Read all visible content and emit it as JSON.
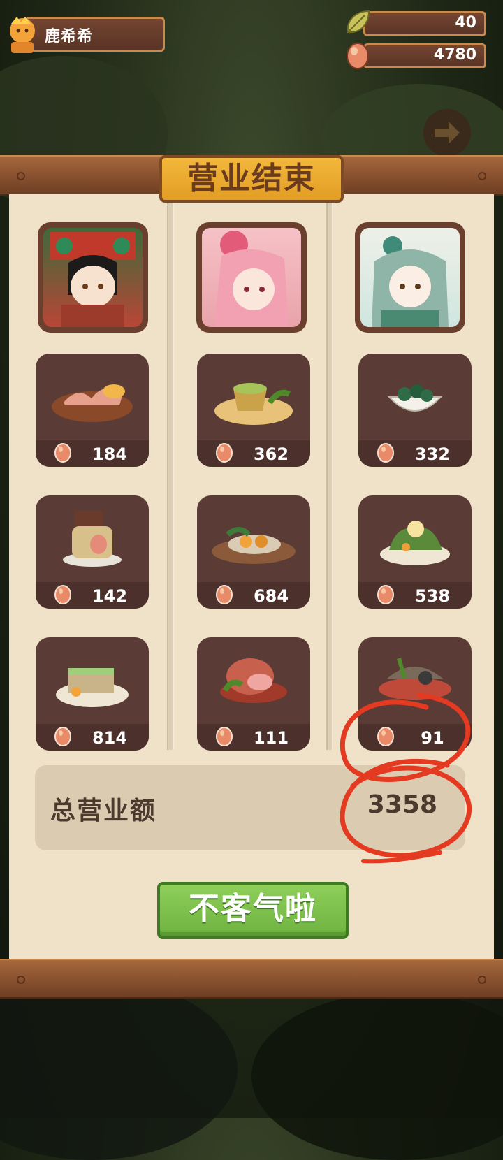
{
  "player": {
    "name": "鹿希希"
  },
  "resources": {
    "leaves": "40",
    "coins": "4780"
  },
  "dialog": {
    "title": "营业结束",
    "button_label": "不客气啦"
  },
  "total": {
    "label": "总营业额",
    "amount": "3358"
  },
  "dishes": [
    {
      "price": "184"
    },
    {
      "price": "362"
    },
    {
      "price": "332"
    },
    {
      "price": "142"
    },
    {
      "price": "684"
    },
    {
      "price": "538"
    },
    {
      "price": "814"
    },
    {
      "price": "111"
    },
    {
      "price": "91"
    }
  ],
  "colors": {
    "annotation": "#e53a22",
    "button": "#7cc04b",
    "title_tab": "#eba930"
  },
  "icons": [
    "player-avatar-icon",
    "leaf-icon",
    "coin-egg-icon",
    "arrow-right-icon"
  ]
}
